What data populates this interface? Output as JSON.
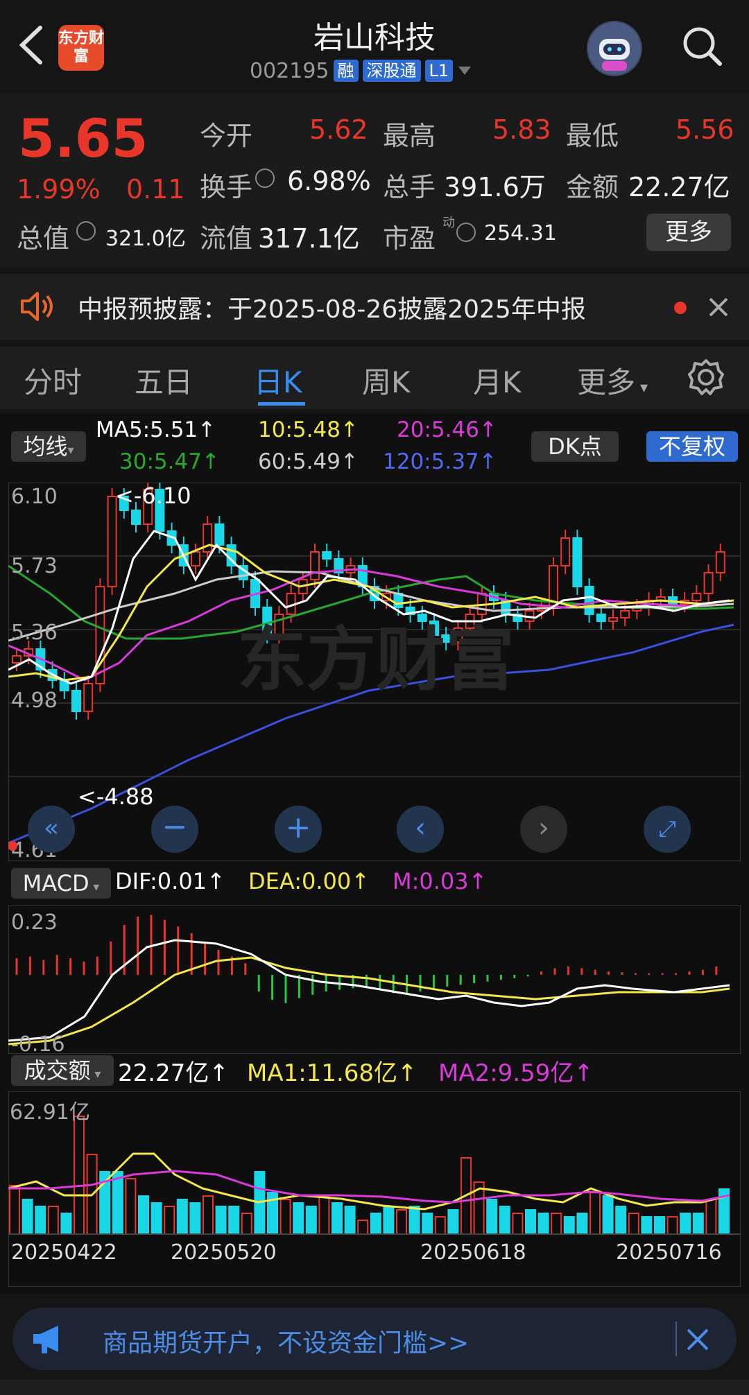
{
  "header": {
    "back_icon": "chevron-left-icon",
    "app_logo_text": "东方财富",
    "stock_name": "岩山科技",
    "stock_code": "002195",
    "tags": [
      "融",
      "深股通",
      "L1"
    ],
    "assistant_icon": "robot-avatar-icon",
    "search_icon": "search-icon"
  },
  "quote": {
    "price": "5.65",
    "change_pct": "1.99%",
    "change_amt": "0.11",
    "open_label": "今开",
    "open": "5.62",
    "high_label": "最高",
    "high": "5.83",
    "low_label": "最低",
    "low": "5.56",
    "turnover_label": "换手",
    "turnover": "6.98%",
    "volume_label": "总手",
    "volume": "391.6万",
    "amount_label": "金额",
    "amount": "22.27亿",
    "mcap_label": "总值",
    "mcap": "321.0亿",
    "float_label": "流值",
    "float_cap": "317.1亿",
    "pe_label": "市盈",
    "pe_sup": "动",
    "pe": "254.31",
    "more_label": "更多",
    "colors": {
      "up": "#e8362a",
      "down": "#19d7e6"
    }
  },
  "notice": {
    "icon": "speaker-icon",
    "text": "中报预披露：于2025-08-26披露2025年中报",
    "close_icon": "close-icon"
  },
  "tabs": {
    "items": [
      "分时",
      "五日",
      "日K",
      "周K",
      "月K",
      "更多"
    ],
    "active": "日K",
    "settings_icon": "gear-icon"
  },
  "kline": {
    "ma_selector": "均线",
    "ma5": "MA5:5.51↑",
    "ma10": "10:5.48↑",
    "ma20": "20:5.46↑",
    "ma30": "30:5.47↑",
    "ma60": "60:5.49↑",
    "ma120": "120:5.37↑",
    "dk_button": "DK点",
    "adjust_button": "不复权",
    "y_labels": [
      "6.10",
      "5.73",
      "5.36",
      "4.98",
      "4.61"
    ],
    "max_marker": "<-6.10",
    "min_marker": "<-4.88",
    "watermark": "东方财富",
    "colors": {
      "ma5": "#ffffff",
      "ma10": "#f5e84a",
      "ma20": "#d93ad9",
      "ma30": "#28a82e",
      "ma60": "#cccccc",
      "ma120": "#3c50e0"
    }
  },
  "macd": {
    "selector": "MACD",
    "dif": "DIF:0.01↑",
    "dea": "DEA:0.00↑",
    "m": "M:0.03↑",
    "y_top": "0.23",
    "y_bottom": "-0.16"
  },
  "amount_chart": {
    "selector": "成交额",
    "value": "22.27亿↑",
    "ma1": "MA1:11.68亿↑",
    "ma2": "MA2:9.59亿↑",
    "y_top": "62.91亿",
    "dates": [
      "20250422",
      "20250520",
      "20250618",
      "20250716"
    ]
  },
  "banner": {
    "icon": "megaphone-icon",
    "text": "商品期货开户，不设资金门槛>>",
    "close_icon": "close-icon"
  }
}
